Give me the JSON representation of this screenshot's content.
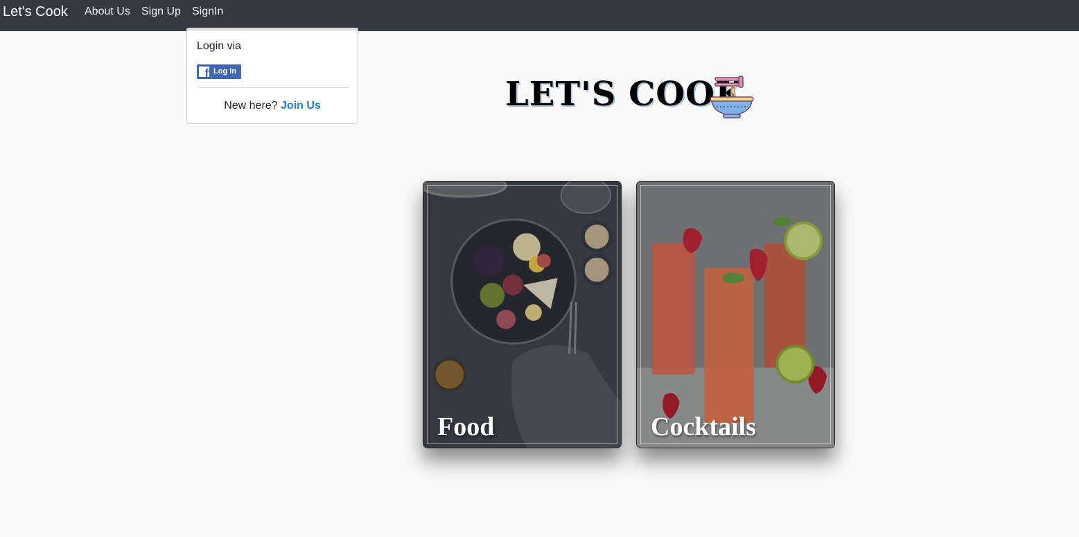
{
  "navbar": {
    "brand": "Let's Cook",
    "links": [
      "About Us",
      "Sign Up",
      "SignIn"
    ]
  },
  "login_dropdown": {
    "heading": "Login via",
    "facebook_button_label": "Log In",
    "new_here_text": "New here?",
    "join_link": "Join Us"
  },
  "hero": {
    "title": "LET'S COOK",
    "icon": "noodle-bowl-icon"
  },
  "cards": [
    {
      "title": "Food",
      "image": "food-platter-image"
    },
    {
      "title": "Cocktails",
      "image": "cocktail-glasses-image"
    }
  ],
  "colors": {
    "navbar": "#343a40",
    "page_background": "#f9f9f9",
    "link_accent": "#1a7fd6",
    "facebook_blue": "#4267b2"
  }
}
